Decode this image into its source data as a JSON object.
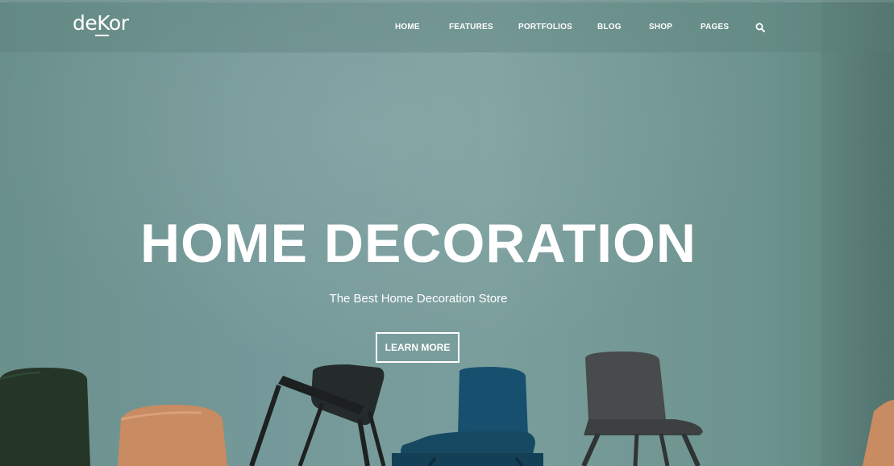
{
  "brand": {
    "logo_text": "deKor"
  },
  "nav": {
    "items": [
      {
        "label": "HOME"
      },
      {
        "label": "FEATURES"
      },
      {
        "label": "PORTFOLIOS"
      },
      {
        "label": "BLOG"
      },
      {
        "label": "SHOP"
      },
      {
        "label": "PAGES"
      }
    ],
    "search_icon": "search-icon"
  },
  "hero": {
    "title": "HOME DECORATION",
    "subtitle": "The Best Home Decoration Store",
    "cta_label": "LEARN MORE"
  },
  "colors": {
    "wall": "#76999a",
    "text": "#ffffff",
    "chair_blue": "#17506e",
    "chair_wood": "#c98b62",
    "chair_black": "#252a2a",
    "chair_grey": "#474b4b",
    "chair_green": "#253528"
  }
}
